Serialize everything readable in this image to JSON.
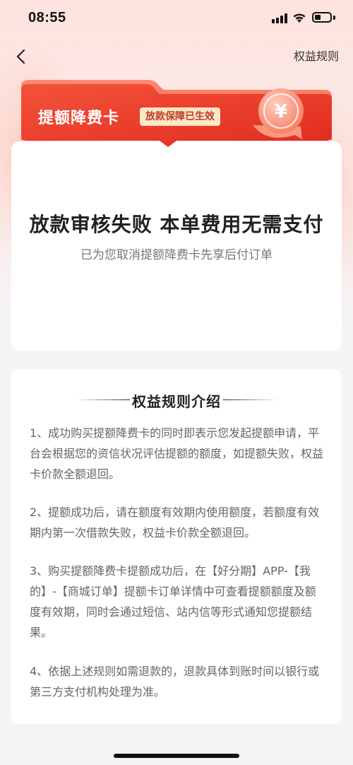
{
  "status_bar": {
    "time": "08:55"
  },
  "nav": {
    "rules_link": "权益规则"
  },
  "banner": {
    "title": "提额降费卡",
    "badge": "放款保障已生效",
    "coin_symbol": "¥",
    "colors": {
      "start": "#f4523a",
      "end": "#e23a2c",
      "badge_bg": "#fde9c4"
    }
  },
  "main": {
    "title": "放款审核失败 本单费用无需支付",
    "subtitle": "已为您取消提额降费卡先享后付订单"
  },
  "rules": {
    "heading": "权益规则介绍",
    "items": [
      "1、成功购买提额降费卡的同时即表示您发起提额申请，平台会根据您的资信状况评估提额的额度，如提额失败，权益卡价款全额退回。",
      "2、提额成功后，请在额度有效期内使用额度，若额度有效期内第一次借款失败，权益卡价款全额退回。",
      "3、购买提额降费卡提额成功后，在【好分期】APP-【我的】-【商城订单】提额卡订单详情中可查看提额额度及额度有效期，同时会通过短信、站内信等形式通知您提额结果。",
      "4、依据上述规则如需退款的，退款具体到账时间以银行或第三方支付机构处理为准。"
    ]
  }
}
